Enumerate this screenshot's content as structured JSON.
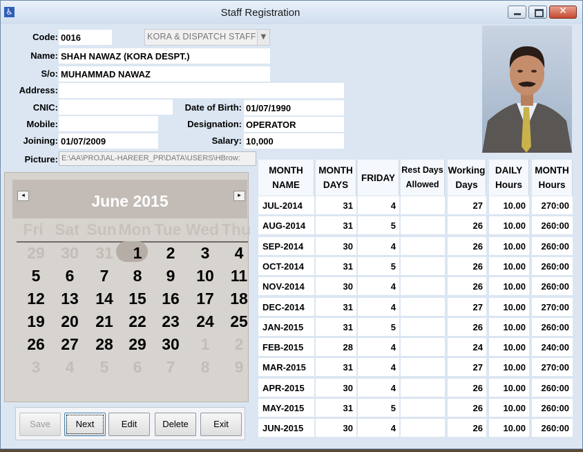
{
  "window": {
    "title": "Staff Registration"
  },
  "form": {
    "code_label": "Code:",
    "code": "0016",
    "category": "KORA & DISPATCH STAFF",
    "name_label": "Name:",
    "name": "SHAH NAWAZ (KORA DESPT.)",
    "so_label": "S/o:",
    "so": "MUHAMMAD NAWAZ",
    "address_label": "Address:",
    "address": "",
    "cnic_label": "CNIC:",
    "cnic": "",
    "dob_label": "Date of Birth:",
    "dob": "01/07/1990",
    "mobile_label": "Mobile:",
    "mobile": "",
    "designation_label": "Designation:",
    "designation": "OPERATOR",
    "joining_label": "Joining:",
    "joining": "01/07/2009",
    "salary_label": "Salary:",
    "salary": "10,000",
    "picture_label": "Picture:",
    "picture_path": "E:\\AA\\PROJ\\AL-HAREER_PR\\DATA\\USERS\\HBrow:"
  },
  "calendar": {
    "month_title": "June 2015",
    "prev_symbol": "◂",
    "next_symbol": "▸",
    "weekdays": [
      "Fri",
      "Sat",
      "Sun",
      "Mon",
      "Tue",
      "Wed",
      "Thu"
    ],
    "weeks": [
      [
        "29",
        "30",
        "31",
        "1",
        "2",
        "3",
        "4"
      ],
      [
        "5",
        "6",
        "7",
        "8",
        "9",
        "10",
        "11"
      ],
      [
        "12",
        "13",
        "14",
        "15",
        "16",
        "17",
        "18"
      ],
      [
        "19",
        "20",
        "21",
        "22",
        "23",
        "24",
        "25"
      ],
      [
        "26",
        "27",
        "28",
        "29",
        "30",
        "1",
        "2"
      ],
      [
        "3",
        "4",
        "5",
        "6",
        "7",
        "8",
        "9"
      ]
    ],
    "selected_day": "1"
  },
  "buttons": {
    "save": "Save",
    "next": "Next",
    "edit": "Edit",
    "delete": "Delete",
    "exit": "Exit"
  },
  "table": {
    "headers": [
      "MONTH NAME",
      "MONTH DAYS",
      "FRIDAY",
      "Rest Days Allowed",
      "Working Days",
      "DAILY Hours",
      "MONTH Hours"
    ],
    "rows": [
      [
        "JUL-2014",
        "31",
        "4",
        "",
        "27",
        "10.00",
        "270:00"
      ],
      [
        "AUG-2014",
        "31",
        "5",
        "",
        "26",
        "10.00",
        "260:00"
      ],
      [
        "SEP-2014",
        "30",
        "4",
        "",
        "26",
        "10.00",
        "260:00"
      ],
      [
        "OCT-2014",
        "31",
        "5",
        "",
        "26",
        "10.00",
        "260:00"
      ],
      [
        "NOV-2014",
        "30",
        "4",
        "",
        "26",
        "10.00",
        "260:00"
      ],
      [
        "DEC-2014",
        "31",
        "4",
        "",
        "27",
        "10.00",
        "270:00"
      ],
      [
        "JAN-2015",
        "31",
        "5",
        "",
        "26",
        "10.00",
        "260:00"
      ],
      [
        "FEB-2015",
        "28",
        "4",
        "",
        "24",
        "10.00",
        "240:00"
      ],
      [
        "MAR-2015",
        "31",
        "4",
        "",
        "27",
        "10.00",
        "270:00"
      ],
      [
        "APR-2015",
        "30",
        "4",
        "",
        "26",
        "10.00",
        "260:00"
      ],
      [
        "MAY-2015",
        "31",
        "5",
        "",
        "26",
        "10.00",
        "260:00"
      ],
      [
        "JUN-2015",
        "30",
        "4",
        "",
        "26",
        "10.00",
        "260:00"
      ]
    ]
  }
}
